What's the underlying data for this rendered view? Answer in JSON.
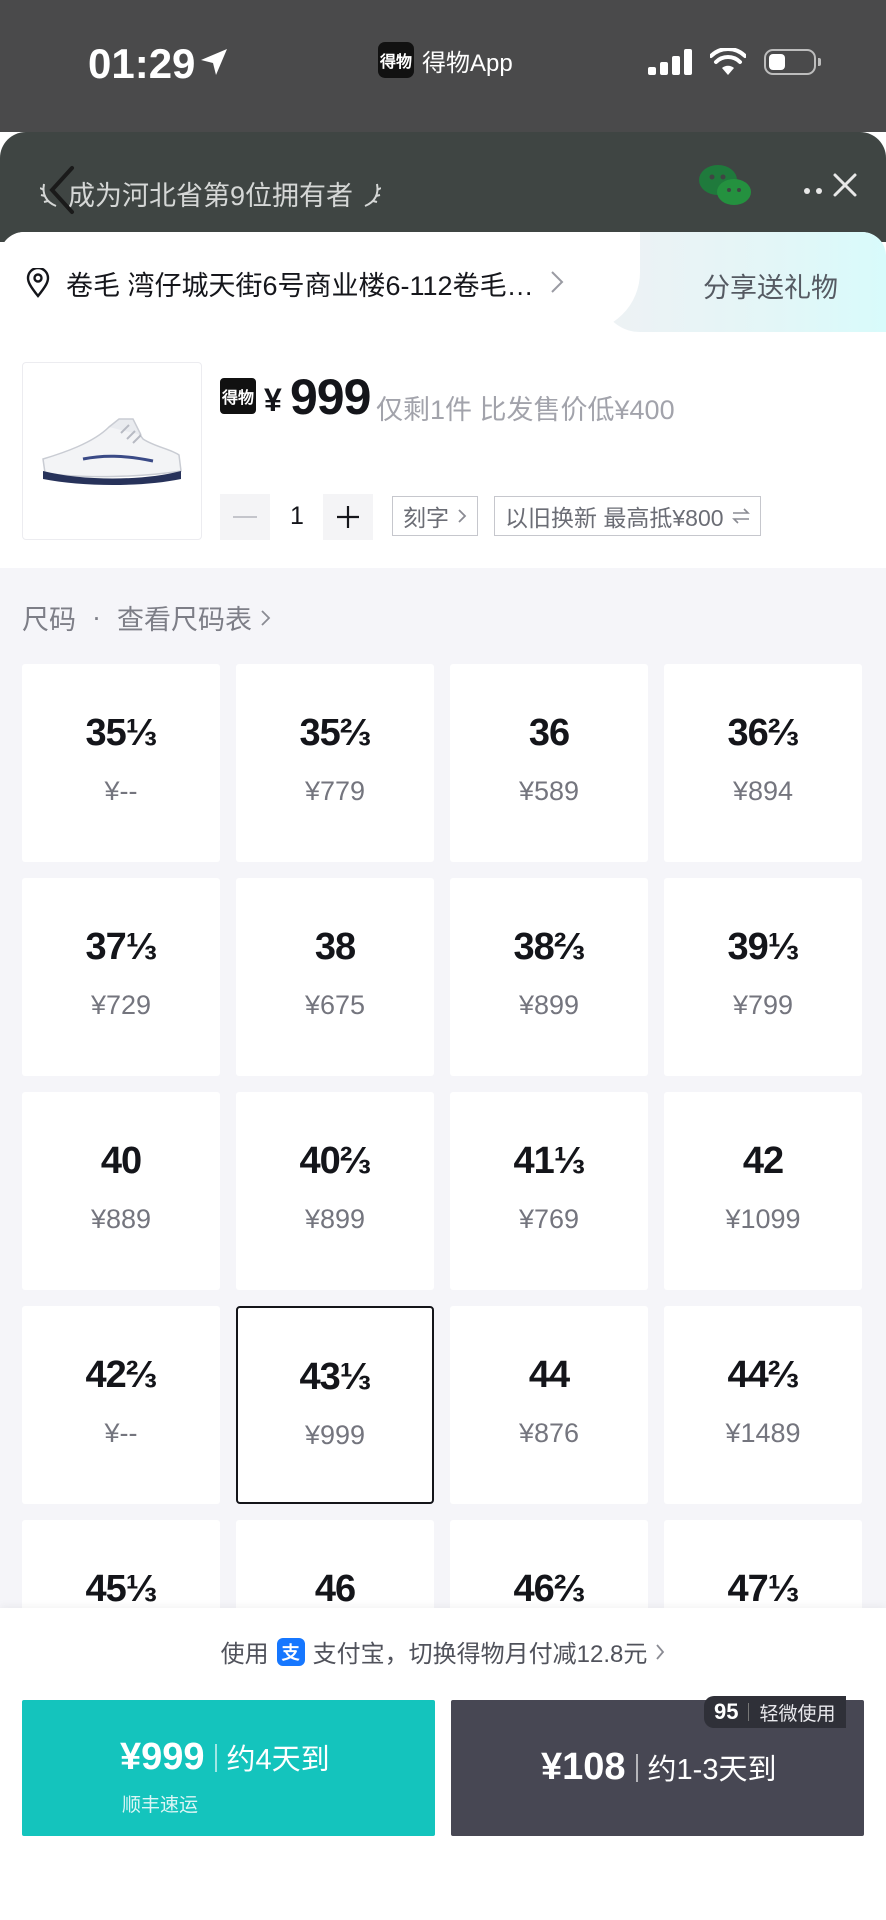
{
  "status_bar": {
    "time": "01:29",
    "app_name": "得物App",
    "app_logo_text": "得物"
  },
  "header": {
    "owner_text": "成为河北省第9位拥有者"
  },
  "address": {
    "text": "卷毛 湾仔城天街6号商业楼6-112卷毛…",
    "share_label": "分享送礼物"
  },
  "product": {
    "logo_text": "得物",
    "currency": "¥",
    "price": "999",
    "stock_note": "仅剩1件 比发售价低¥400",
    "quantity": "1",
    "engrave_label": "刻字",
    "tradein_label": "以旧换新 最高抵¥800"
  },
  "size_section": {
    "title": "尺码",
    "dot": "·",
    "chart_link": "查看尺码表"
  },
  "sizes": [
    {
      "size": "35⅓",
      "price": "¥--"
    },
    {
      "size": "35⅔",
      "price": "¥779"
    },
    {
      "size": "36",
      "price": "¥589"
    },
    {
      "size": "36⅔",
      "price": "¥894"
    },
    {
      "size": "37⅓",
      "price": "¥729"
    },
    {
      "size": "38",
      "price": "¥675"
    },
    {
      "size": "38⅔",
      "price": "¥899"
    },
    {
      "size": "39⅓",
      "price": "¥799"
    },
    {
      "size": "40",
      "price": "¥889"
    },
    {
      "size": "40⅔",
      "price": "¥899"
    },
    {
      "size": "41⅓",
      "price": "¥769"
    },
    {
      "size": "42",
      "price": "¥1099"
    },
    {
      "size": "42⅔",
      "price": "¥--"
    },
    {
      "size": "43⅓",
      "price": "¥999"
    },
    {
      "size": "44",
      "price": "¥876"
    },
    {
      "size": "44⅔",
      "price": "¥1489"
    },
    {
      "size": "45⅓",
      "price": ""
    },
    {
      "size": "46",
      "price": ""
    },
    {
      "size": "46⅔",
      "price": ""
    },
    {
      "size": "47⅓",
      "price": ""
    }
  ],
  "selected_size": "43⅓",
  "bottom": {
    "promo_prefix": "使用",
    "alipay_icon_text": "支",
    "promo_text": "支付宝，切换得物月付减12.8元",
    "buy_price": "¥999",
    "buy_eta": "约4天到",
    "buy_sub": "顺丰速运",
    "alt_price": "¥108",
    "alt_eta": "约1-3天到",
    "alt_badge_num": "95",
    "alt_badge_text": "轻微使用"
  },
  "colors": {
    "accent": "#14c4bd",
    "dark_button": "#474753",
    "size_area_bg": "#f5f5f9"
  }
}
